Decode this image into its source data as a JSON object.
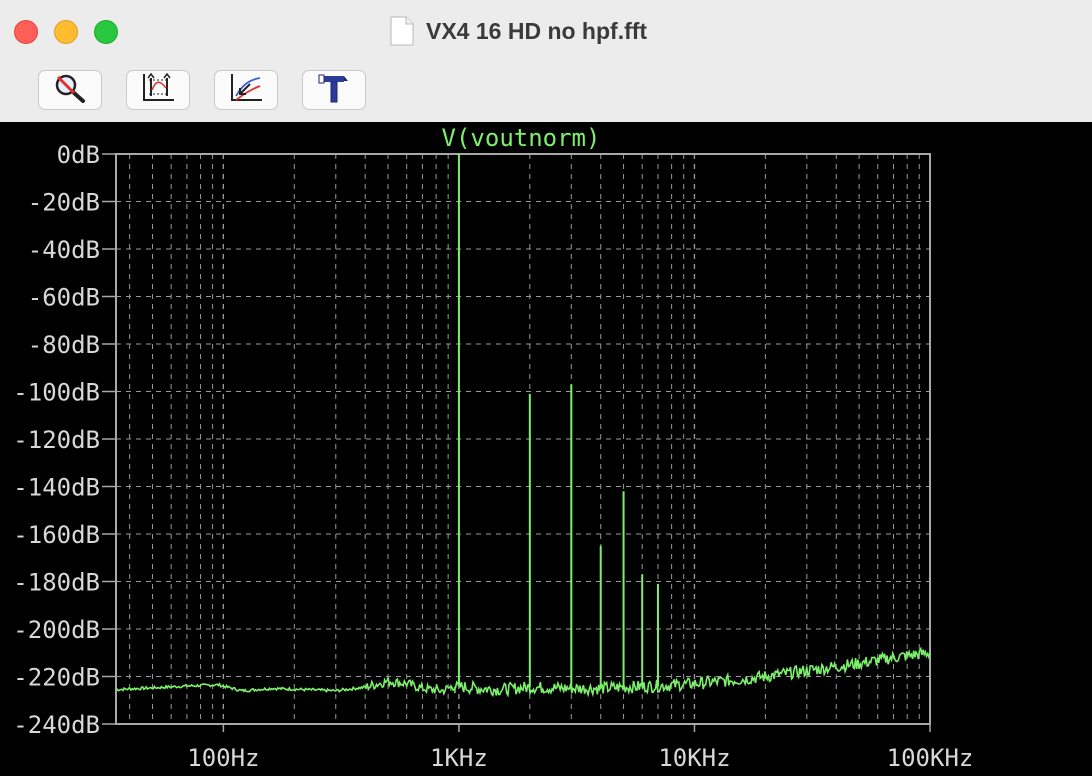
{
  "window": {
    "title": "VX4 16 HD no hpf.fft",
    "doc_icon": "document-icon"
  },
  "toolbar": {
    "buttons": [
      {
        "icon": "zoom-cancel-icon"
      },
      {
        "icon": "autorange-icon"
      },
      {
        "icon": "pick-trace-icon"
      },
      {
        "icon": "hammer-icon"
      }
    ]
  },
  "colors": {
    "background": "#000000",
    "trace": "#7cf06a",
    "grid": "#9a9a9a",
    "tick_text": "#d8d8d8",
    "frame": "#a8a8a8"
  },
  "chart_data": {
    "type": "line",
    "title": "V(voutnorm)",
    "xscale": "log",
    "xlim": [
      35,
      100000
    ],
    "ylim": [
      -240,
      0
    ],
    "grid": true,
    "yticks": [
      0,
      -20,
      -40,
      -60,
      -80,
      -100,
      -120,
      -140,
      -160,
      -180,
      -200,
      -220,
      -240
    ],
    "yticklabels": [
      "0dB",
      "-20dB",
      "-40dB",
      "-60dB",
      "-80dB",
      "-100dB",
      "-120dB",
      "-140dB",
      "-160dB",
      "-180dB",
      "-200dB",
      "-220dB",
      "-240dB"
    ],
    "xticks": [
      100,
      1000,
      10000,
      100000
    ],
    "xticklabels": [
      "100Hz",
      "1KHz",
      "10KHz",
      "100KHz"
    ],
    "series": [
      {
        "name": "V(voutnorm)",
        "noise_floor": [
          {
            "x": 35,
            "y": -225.5
          },
          {
            "x": 50,
            "y": -224.8
          },
          {
            "x": 70,
            "y": -224
          },
          {
            "x": 95,
            "y": -223.5
          },
          {
            "x": 120,
            "y": -226
          },
          {
            "x": 160,
            "y": -225
          },
          {
            "x": 220,
            "y": -225.5
          },
          {
            "x": 300,
            "y": -226
          },
          {
            "x": 400,
            "y": -224.5
          },
          {
            "x": 500,
            "y": -222
          },
          {
            "x": 600,
            "y": -223
          },
          {
            "x": 700,
            "y": -225
          },
          {
            "x": 850,
            "y": -226
          },
          {
            "x": 950,
            "y": -224
          },
          {
            "x": 1200,
            "y": -225
          },
          {
            "x": 1500,
            "y": -225.5
          },
          {
            "x": 2000,
            "y": -224.5
          },
          {
            "x": 3000,
            "y": -225
          },
          {
            "x": 4000,
            "y": -225
          },
          {
            "x": 5000,
            "y": -224.5
          },
          {
            "x": 7000,
            "y": -224
          },
          {
            "x": 10000,
            "y": -223
          },
          {
            "x": 15000,
            "y": -221.5
          },
          {
            "x": 20000,
            "y": -220
          },
          {
            "x": 30000,
            "y": -217.5
          },
          {
            "x": 50000,
            "y": -214.5
          },
          {
            "x": 70000,
            "y": -212
          },
          {
            "x": 100000,
            "y": -210
          }
        ],
        "peaks": [
          {
            "x": 1000,
            "y": 0
          },
          {
            "x": 2000,
            "y": -101
          },
          {
            "x": 3000,
            "y": -97
          },
          {
            "x": 4000,
            "y": -165
          },
          {
            "x": 5000,
            "y": -142
          },
          {
            "x": 6000,
            "y": -177
          },
          {
            "x": 7000,
            "y": -181
          }
        ]
      }
    ]
  }
}
